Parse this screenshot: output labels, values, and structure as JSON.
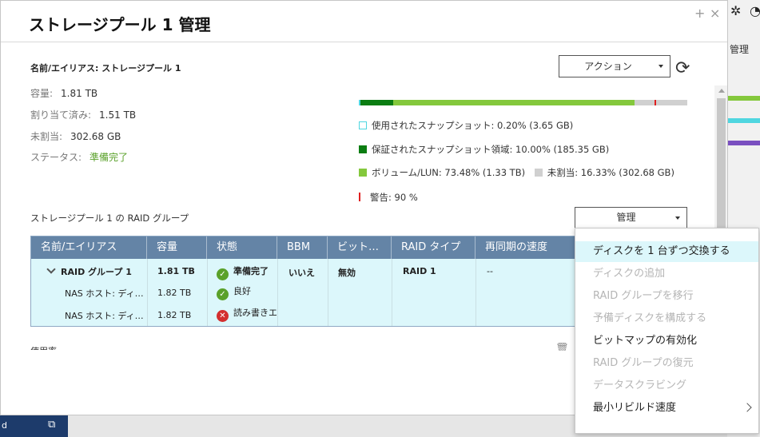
{
  "background": {
    "manage_label": "管理",
    "left_strip_text": "d"
  },
  "modal": {
    "title": "ストレージプール 1 管理",
    "win_plus": "+",
    "win_close": "×"
  },
  "pool": {
    "name_line": "名前/エイリアス: ストレージプール 1",
    "capacity_label": "容量:",
    "capacity_value": "1.81 TB",
    "allocated_label": "割り当て済み:",
    "allocated_value": "1.51 TB",
    "unallocated_label": "未割当:",
    "unallocated_value": "302.68 GB",
    "status_label": "ステータス:",
    "status_value": "準備完了"
  },
  "actions": {
    "action_label": "アクション",
    "manage_label": "管理"
  },
  "usage": {
    "snapshot_used_pct": 0.2,
    "guaranteed_snapshot_pct": 10.0,
    "volume_lun_pct": 73.48,
    "unallocated_pct": 16.33,
    "warning_pct": 90,
    "colors": {
      "snapshot_used": "#4fd6e0",
      "guaranteed": "#0b7d12",
      "volume": "#84c83c",
      "unallocated": "#d0d0d0",
      "warning": "#e02020"
    },
    "legend": {
      "snapshot_used": "使用されたスナップショット: 0.20% (3.65 GB)",
      "guaranteed": "保証されたスナップショット領域: 10.00% (185.35 GB)",
      "volume": "ボリューム/LUN: 73.48% (1.33 TB)",
      "unallocated": "未割当: 16.33% (302.68 GB)",
      "warning": "警告: 90 %"
    }
  },
  "raid": {
    "section_title": "ストレージプール 1 の RAID グループ",
    "columns": [
      "名前/エイリアス",
      "容量",
      "状態",
      "BBM",
      "ビット…",
      "RAID タイプ",
      "再同期の速度"
    ],
    "group": {
      "name": "RAID グループ 1",
      "capacity": "1.81 TB",
      "status": "準備完了",
      "bbm": "いいえ",
      "bitmap": "無効",
      "raid_type": "RAID 1",
      "resync": "--"
    },
    "disks": [
      {
        "name": "NAS ホスト: ディ…",
        "capacity": "1.82 TB",
        "status": "良好",
        "state": "ok"
      },
      {
        "name": "NAS ホスト: ディ…",
        "capacity": "1.82 TB",
        "status": "読み書きエ",
        "state": "error"
      }
    ]
  },
  "menu": {
    "items": [
      {
        "label": "ディスクを 1 台ずつ交換する",
        "enabled": true,
        "highlight": true
      },
      {
        "label": "ディスクの追加",
        "enabled": false
      },
      {
        "label": "RAID グループを移行",
        "enabled": false
      },
      {
        "label": "予備ディスクを構成する",
        "enabled": false
      },
      {
        "label": "ビットマップの有効化",
        "enabled": true
      },
      {
        "label": "RAID グループの復元",
        "enabled": false
      },
      {
        "label": "データスクラビング",
        "enabled": false
      },
      {
        "label": "最小リビルド速度",
        "enabled": true,
        "submenu": true
      }
    ]
  },
  "bottom_cut_text": "使用率"
}
